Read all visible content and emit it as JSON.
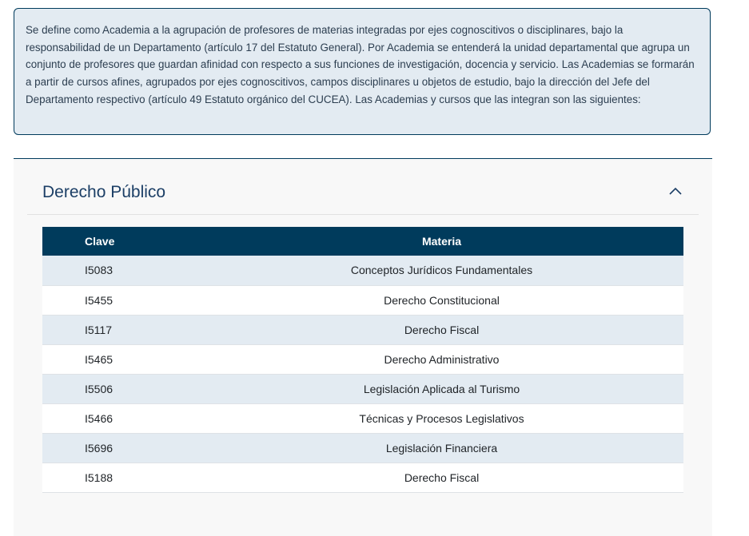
{
  "intro": {
    "text": "Se define como Academia a la agrupación de profesores de materias integradas por ejes cognoscitivos o disciplinares, bajo la responsabilidad de un Departamento (artículo 17 del Estatuto General). Por Academia se entenderá la unidad departamental que agrupa un conjunto de profesores que guardan afinidad con respecto a sus funciones de investigación, docencia y servicio. Las Academias se formarán a partir de cursos afines, agrupados por ejes cognoscitivos, campos disciplinares u objetos de estudio, bajo la dirección del Jefe del Departamento respectivo (artículo 49 Estatuto orgánico del CUCEA). Las Academias y cursos que las integran son las siguientes:"
  },
  "accordion": {
    "title": "Derecho Público",
    "expanded_icon": "chevron-up-icon",
    "table": {
      "headers": {
        "clave": "Clave",
        "materia": "Materia"
      },
      "rows": [
        {
          "clave": "I5083",
          "materia": "Conceptos Jurídicos Fundamentales"
        },
        {
          "clave": "I5455",
          "materia": "Derecho Constitucional"
        },
        {
          "clave": "I5117",
          "materia": "Derecho Fiscal"
        },
        {
          "clave": "I5465",
          "materia": "Derecho Administrativo"
        },
        {
          "clave": "I5506",
          "materia": "Legislación Aplicada al Turismo"
        },
        {
          "clave": "I5466",
          "materia": "Técnicas y Procesos Legislativos"
        },
        {
          "clave": "I5696",
          "materia": "Legislación Financiera"
        },
        {
          "clave": "I5188",
          "materia": "Derecho Fiscal"
        }
      ]
    }
  },
  "colors": {
    "header_bg": "#003b5c",
    "stripe_bg": "#e3ebf2",
    "title_color": "#1c3f66"
  }
}
